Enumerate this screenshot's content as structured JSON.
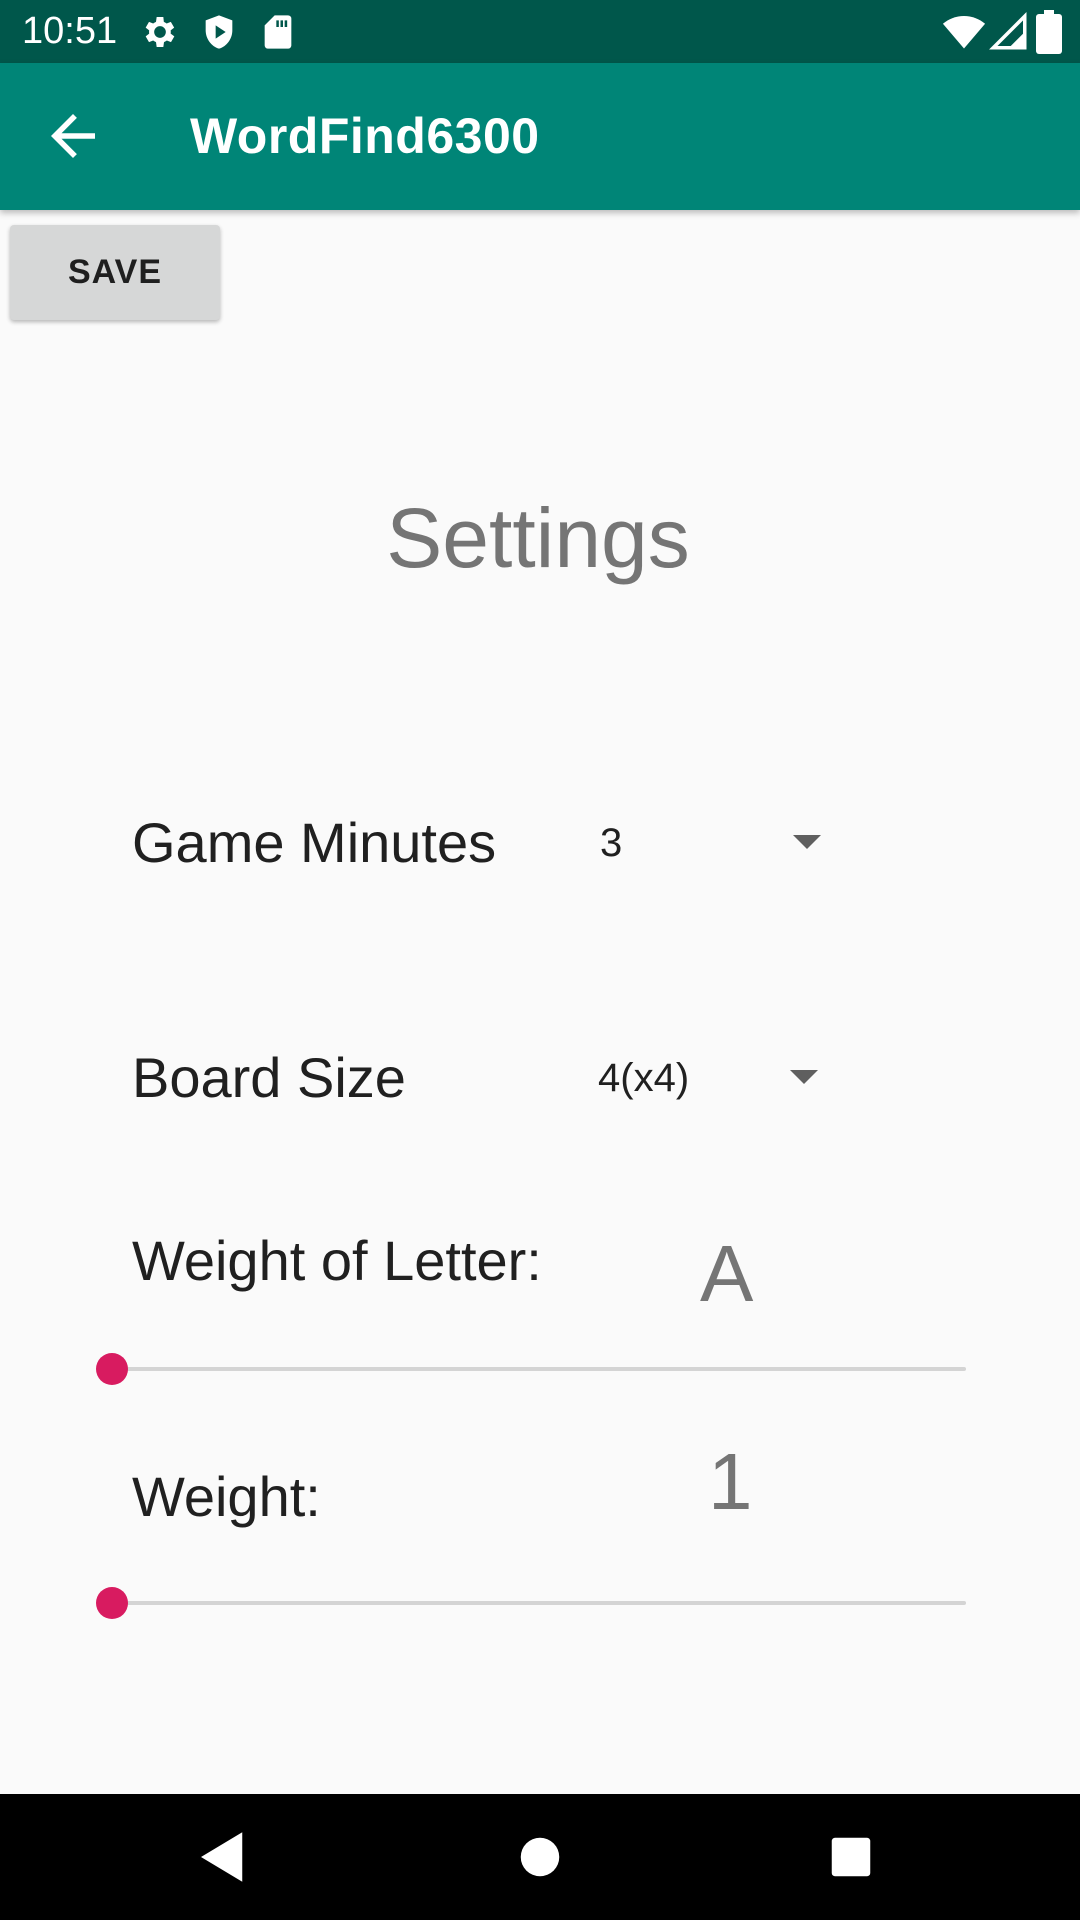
{
  "status_bar": {
    "time": "10:51",
    "left_icons": [
      "gear-icon",
      "shield-icon",
      "sd-card-icon"
    ],
    "right_icons": [
      "wifi-icon",
      "cell-signal-icon",
      "battery-icon"
    ]
  },
  "app_bar": {
    "title": "WordFind6300",
    "back_icon": "arrow-back-icon"
  },
  "toolbar": {
    "save_label": "SAVE"
  },
  "main": {
    "heading": "Settings",
    "game_minutes": {
      "label": "Game Minutes",
      "selected": "3"
    },
    "board_size": {
      "label": "Board Size",
      "selected": "4(x4)"
    },
    "weight_of_letter": {
      "label": "Weight of Letter:",
      "value": "A",
      "slider_fraction": 0
    },
    "weight": {
      "label": "Weight:",
      "value": "1",
      "slider_fraction": 0
    }
  },
  "nav_bar": {
    "icons": [
      "back-triangle-icon",
      "home-circle-icon",
      "recents-square-icon"
    ]
  },
  "colors": {
    "status_bar": "#00574b",
    "app_bar": "#008577",
    "accent": "#d81b60",
    "background": "#fafafa"
  }
}
